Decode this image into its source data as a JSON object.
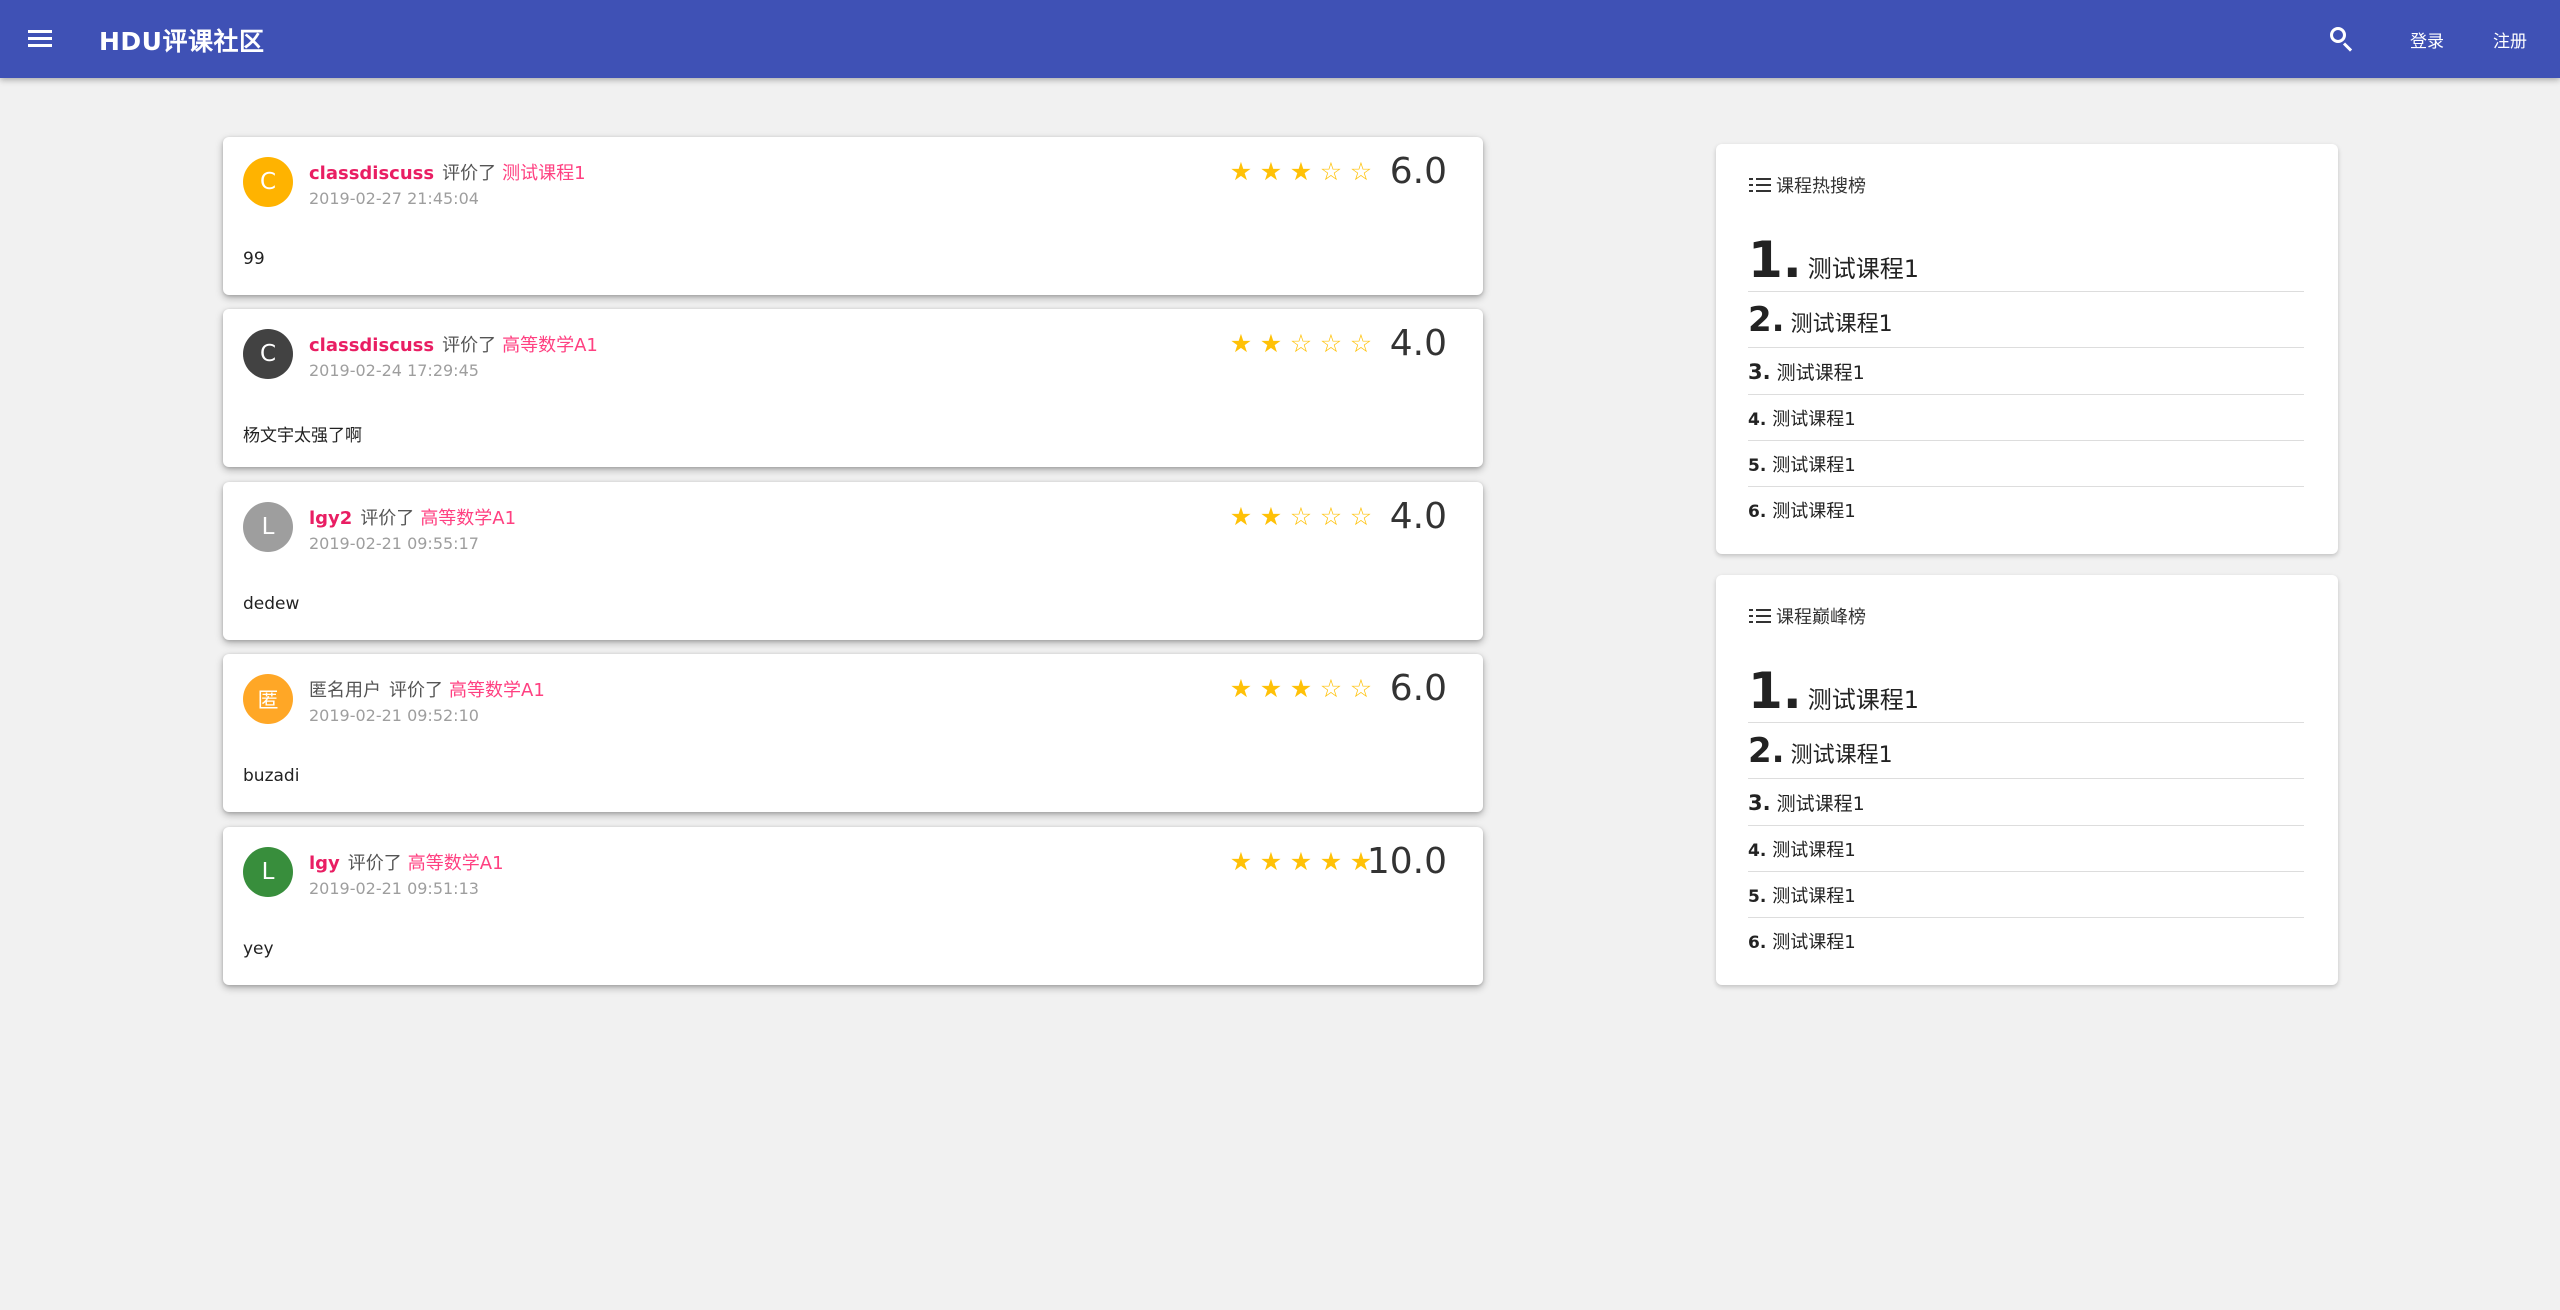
{
  "appbar": {
    "title": "HDU评课社区",
    "menu_icon": "menu-icon",
    "search_icon": "search-icon",
    "login_label": "登录",
    "register_label": "注册",
    "color": "#3f51b5"
  },
  "reviews": [
    {
      "avatar_letter": "C",
      "avatar_color": "#ffb300",
      "user": "classdiscuss",
      "verb": "评价了",
      "course": "测试课程1",
      "time": "2019-02-27 21:45:04",
      "stars_filled": 3,
      "stars_total": 5,
      "score": "6.0",
      "comment": "99"
    },
    {
      "avatar_letter": "C",
      "avatar_color": "#424242",
      "user": "classdiscuss",
      "verb": "评价了",
      "course": "高等数学A1",
      "time": "2019-02-24 17:29:45",
      "stars_filled": 2,
      "stars_total": 5,
      "score": "4.0",
      "comment": "杨文宇太强了啊"
    },
    {
      "avatar_letter": "L",
      "avatar_color": "#9e9e9e",
      "user": "lgy2",
      "verb": "评价了",
      "course": "高等数学A1",
      "time": "2019-02-21 09:55:17",
      "stars_filled": 2,
      "stars_total": 5,
      "score": "4.0",
      "comment": "dedew"
    },
    {
      "avatar_letter": "匿",
      "avatar_color": "#ffa726",
      "user": "匿名用户",
      "verb": "评价了",
      "course": "高等数学A1",
      "time": "2019-02-21 09:52:10",
      "stars_filled": 3,
      "stars_total": 5,
      "score": "6.0",
      "comment": "buzadi"
    },
    {
      "avatar_letter": "L",
      "avatar_color": "#388e3c",
      "user": "lgy",
      "verb": "评价了",
      "course": "高等数学A1",
      "time": "2019-02-21 09:51:13",
      "stars_filled": 5,
      "stars_total": 5,
      "score": "10.0",
      "comment": "yey"
    }
  ],
  "hot_ranking": {
    "title": "课程热搜榜",
    "icon": "list-icon",
    "items": [
      {
        "rank": "1.",
        "name": "测试课程1"
      },
      {
        "rank": "2.",
        "name": "测试课程1"
      },
      {
        "rank": "3.",
        "name": "测试课程1"
      },
      {
        "rank": "4.",
        "name": "测试课程1"
      },
      {
        "rank": "5.",
        "name": "测试课程1"
      },
      {
        "rank": "6.",
        "name": "测试课程1"
      }
    ]
  },
  "peak_ranking": {
    "title": "课程巅峰榜",
    "icon": "list-icon",
    "items": [
      {
        "rank": "1.",
        "name": "测试课程1"
      },
      {
        "rank": "2.",
        "name": "测试课程1"
      },
      {
        "rank": "3.",
        "name": "测试课程1"
      },
      {
        "rank": "4.",
        "name": "测试课程1"
      },
      {
        "rank": "5.",
        "name": "测试课程1"
      },
      {
        "rank": "6.",
        "name": "测试课程1"
      }
    ]
  },
  "colors": {
    "accent_pink": "#e91e63",
    "star": "#ffc107",
    "background": "#f1f1f1"
  }
}
